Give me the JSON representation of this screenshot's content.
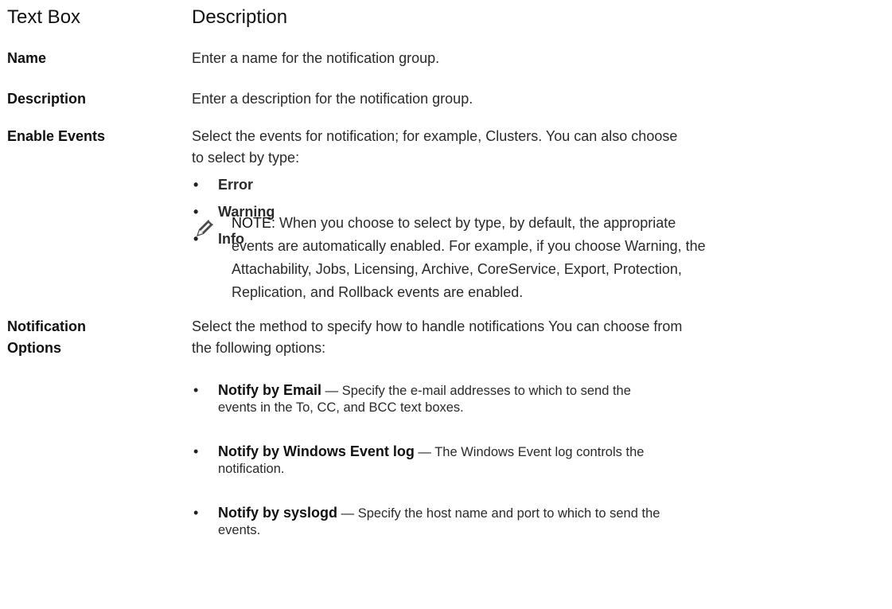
{
  "table": {
    "headers": {
      "col1": "Text Box",
      "col2": "Description"
    },
    "rows": {
      "name": {
        "term": "Name",
        "description": "Enter a name for the notification group."
      },
      "description": {
        "term": "Description",
        "description": "Enter a description for the notification group."
      },
      "enable_events": {
        "term": "Enable Events",
        "description_line1": "Select the events for notification; for example, Clusters. You can also choose",
        "description_line2": "to select by type:",
        "types": [
          "Error",
          "Warning",
          "Info"
        ],
        "note": {
          "label": "NOTE:",
          "line1": " When you choose to select by type, by default, the appropriate",
          "line2": "events are automatically enabled. For example, if you choose Warning, the",
          "line3": "Attachability, Jobs, Licensing, Archive, CoreService, Export, Protection,",
          "line4": "Replication, and Rollback events are enabled."
        }
      },
      "notification_options": {
        "term_line1": "Notification",
        "term_line2": "Options",
        "description_line1": "Select the method to specify how to handle notifications You can choose from",
        "description_line2": "the following options:",
        "options": [
          {
            "name": "Notify by Email",
            "line1": " — Specify the e-mail addresses to which to send the",
            "line2": "events in the To, CC, and BCC text boxes."
          },
          {
            "name": "Notify by Windows Event log",
            "line1": " — The Windows Event log controls the",
            "line2": "notification."
          },
          {
            "name": "Notify by syslogd",
            "line1": " — Specify the host name and port to which to send the",
            "line2": "events."
          }
        ]
      }
    }
  },
  "icons": {
    "note": "pencil-note-icon"
  }
}
